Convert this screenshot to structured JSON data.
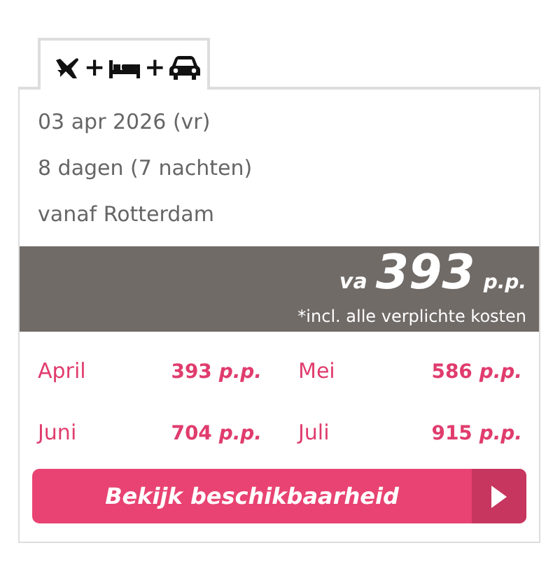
{
  "tab": {
    "parts": [
      {
        "kind": "plane"
      },
      {
        "kind": "plus",
        "text": "+"
      },
      {
        "kind": "bed"
      },
      {
        "kind": "plus",
        "text": "+"
      },
      {
        "kind": "car"
      }
    ]
  },
  "details": [
    "03 apr 2026 (vr)",
    "8 dagen (7 nachten)",
    "vanaf Rotterdam"
  ],
  "price_band": {
    "prefix": "va",
    "price": "393",
    "unit": "p.p.",
    "note": "*incl. alle verplichte kosten"
  },
  "months": [
    {
      "month": "April",
      "price": "393",
      "unit": "p.p."
    },
    {
      "month": "Mei",
      "price": "586",
      "unit": "p.p."
    },
    {
      "month": "Juni",
      "price": "704",
      "unit": "p.p."
    },
    {
      "month": "Juli",
      "price": "915",
      "unit": "p.p."
    }
  ],
  "button": {
    "label": "Bekijk beschikbaarheid"
  }
}
